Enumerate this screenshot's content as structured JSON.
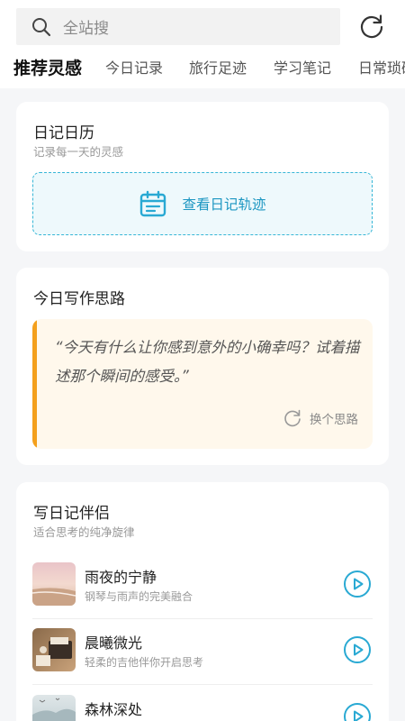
{
  "header": {
    "search_placeholder": "全站搜",
    "search_icon": "search-icon",
    "refresh_icon": "refresh-icon"
  },
  "tabs": [
    {
      "label": "推荐灵感",
      "active": true
    },
    {
      "label": "今日记录",
      "active": false
    },
    {
      "label": "旅行足迹",
      "active": false
    },
    {
      "label": "学习笔记",
      "active": false
    },
    {
      "label": "日常琐碎",
      "active": false
    }
  ],
  "diary_calendar": {
    "title": "日记日历",
    "subtitle": "记录每一天的灵感",
    "button_label": "查看日记轨迹",
    "icon": "calendar-icon"
  },
  "writing_prompt": {
    "title": "今日写作思路",
    "quote": "“今天有什么让你感到意外的小确幸吗？试着描述那个瞬间的感受。”",
    "swap_label": "换个思路",
    "swap_icon": "refresh-icon"
  },
  "music": {
    "title": "写日记伴侣",
    "subtitle": "适合思考的纯净旋律",
    "items": [
      {
        "title": "雨夜的宁静",
        "subtitle": "钢琴与雨声的完美融合"
      },
      {
        "title": "晨曦微光",
        "subtitle": "轻柔的吉他伴你开启思考"
      },
      {
        "title": "森林深处",
        "subtitle": ""
      }
    ]
  },
  "colors": {
    "accent": "#36b6d6",
    "prompt_bar": "#f4a01c",
    "prompt_bg": "#fff8ec"
  }
}
